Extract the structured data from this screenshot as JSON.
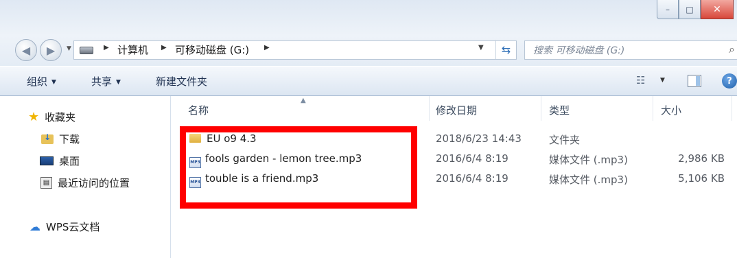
{
  "window": {
    "controls": {
      "minimize": "–",
      "maximize": "□",
      "close": "✕"
    }
  },
  "address": {
    "breadcrumbs": [
      "计算机",
      "可移动磁盘 (G:)"
    ],
    "search_placeholder": "搜索 可移动磁盘 (G:)"
  },
  "toolbar": {
    "organize": "组织",
    "share": "共享",
    "new_folder": "新建文件夹"
  },
  "sidebar": {
    "favorites": "收藏夹",
    "items": [
      {
        "label": "下载",
        "icon": "download-folder-icon"
      },
      {
        "label": "桌面",
        "icon": "desktop-icon"
      },
      {
        "label": "最近访问的位置",
        "icon": "recent-places-icon"
      }
    ],
    "wps": "WPS云文档"
  },
  "columns": {
    "name": "名称",
    "modified": "修改日期",
    "type": "类型",
    "size": "大小"
  },
  "files": [
    {
      "name": "EU o9 4.3",
      "modified": "2018/6/23 14:43",
      "type": "文件夹",
      "size": "",
      "icon": "folder-icon"
    },
    {
      "name": "fools garden - lemon tree.mp3",
      "modified": "2016/6/4 8:19",
      "type": "媒体文件 (.mp3)",
      "size": "2,986 KB",
      "icon": "mp3-file-icon"
    },
    {
      "name": "touble is a friend.mp3",
      "modified": "2016/6/4 8:19",
      "type": "媒体文件 (.mp3)",
      "size": "5,106 KB",
      "icon": "mp3-file-icon"
    }
  ],
  "colors": {
    "highlight_box": "#ff0000",
    "toolbar_text": "#1e3050"
  }
}
